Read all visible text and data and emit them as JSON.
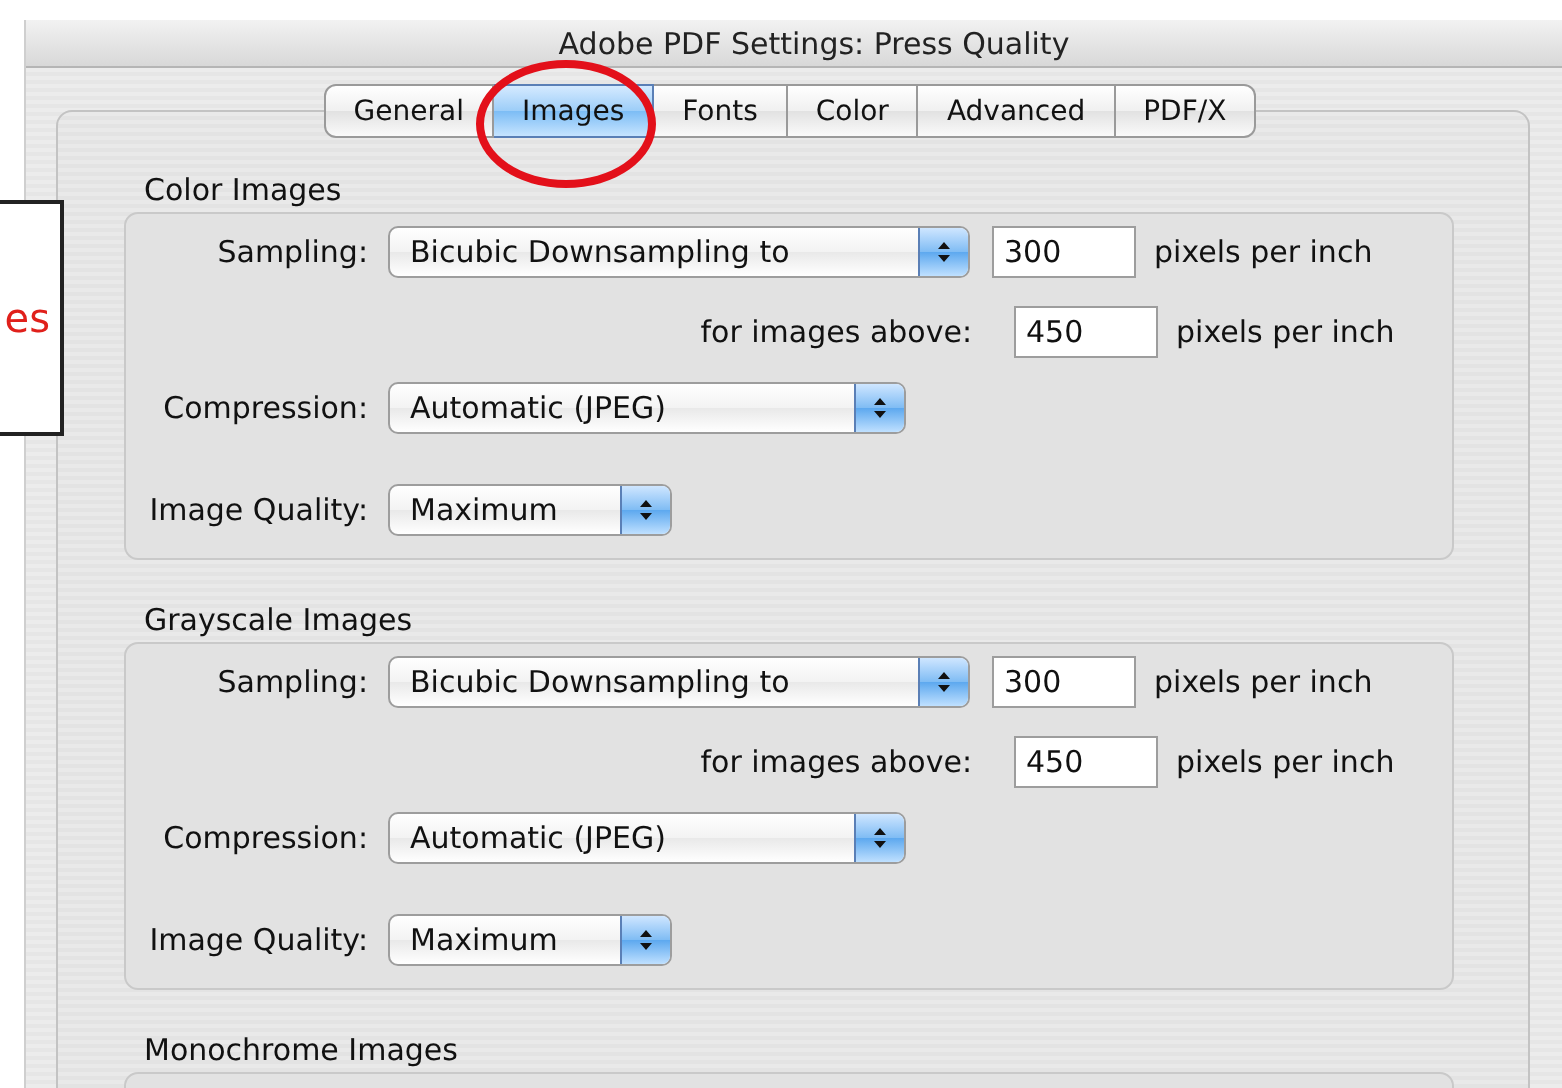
{
  "window": {
    "title": "Adobe PDF Settings: Press Quality"
  },
  "tabs": [
    {
      "label": "General",
      "selected": false
    },
    {
      "label": "Images",
      "selected": true
    },
    {
      "label": "Fonts",
      "selected": false
    },
    {
      "label": "Color",
      "selected": false
    },
    {
      "label": "Advanced",
      "selected": false
    },
    {
      "label": "PDF/X",
      "selected": false
    }
  ],
  "sections": [
    {
      "title": "Color Images",
      "sampling": {
        "label": "Sampling:",
        "value": "Bicubic Downsampling to",
        "resolution": "300",
        "unit": "pixels per inch"
      },
      "above": {
        "label": "for images above:",
        "value": "450",
        "unit": "pixels per inch"
      },
      "compression": {
        "label": "Compression:",
        "value": "Automatic (JPEG)"
      },
      "quality": {
        "label": "Image Quality:",
        "value": "Maximum"
      }
    },
    {
      "title": "Grayscale Images",
      "sampling": {
        "label": "Sampling:",
        "value": "Bicubic Downsampling to",
        "resolution": "300",
        "unit": "pixels per inch"
      },
      "above": {
        "label": "for images above:",
        "value": "450",
        "unit": "pixels per inch"
      },
      "compression": {
        "label": "Compression:",
        "value": "Automatic (JPEG)"
      },
      "quality": {
        "label": "Image Quality:",
        "value": "Maximum"
      }
    },
    {
      "title": "Monochrome Images"
    }
  ],
  "callout": {
    "text": "es"
  }
}
